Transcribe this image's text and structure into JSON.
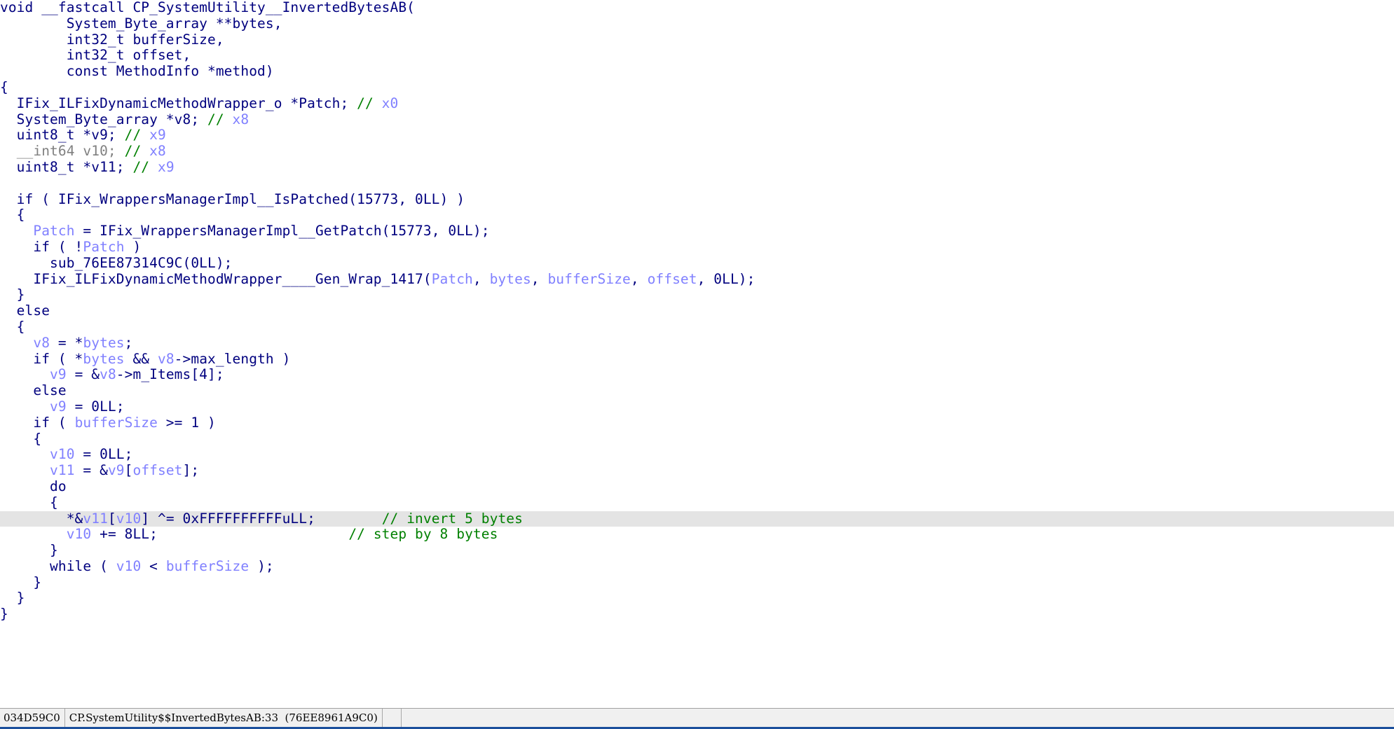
{
  "window": {
    "title": "Pseudocode-A",
    "background": "#ffffff"
  },
  "colors": {
    "default_text": "#00007f",
    "variable": "#8080ff",
    "comment": "#008000",
    "unknown_type": "#808080",
    "highlight_row": "#e4e4e4",
    "status_background": "#f0f0f0",
    "status_rule": "#1b4f9c"
  },
  "code": {
    "language": "C pseudocode",
    "highlighted_line_index": 32,
    "lines": [
      {
        "i": 0,
        "tokens": [
          {
            "c": "plain",
            "t": "void "
          },
          {
            "c": "kw",
            "t": "__fastcall"
          },
          {
            "c": "plain",
            "t": " CP_SystemUtility__InvertedBytesAB("
          }
        ]
      },
      {
        "i": 1,
        "tokens": [
          {
            "c": "plain",
            "t": "        System_Byte_array **bytes,"
          }
        ]
      },
      {
        "i": 2,
        "tokens": [
          {
            "c": "plain",
            "t": "        int32_t bufferSize,"
          }
        ]
      },
      {
        "i": 3,
        "tokens": [
          {
            "c": "plain",
            "t": "        int32_t offset,"
          }
        ]
      },
      {
        "i": 4,
        "tokens": [
          {
            "c": "plain",
            "t": "        const MethodInfo *method)"
          }
        ]
      },
      {
        "i": 5,
        "tokens": [
          {
            "c": "plain",
            "t": "{"
          }
        ]
      },
      {
        "i": 6,
        "tokens": [
          {
            "c": "plain",
            "t": "  IFix_ILFixDynamicMethodWrapper_o *Patch; "
          },
          {
            "c": "cmt",
            "t": "// "
          },
          {
            "c": "rcmt",
            "t": "x0"
          }
        ]
      },
      {
        "i": 7,
        "tokens": [
          {
            "c": "plain",
            "t": "  System_Byte_array *v8; "
          },
          {
            "c": "cmt",
            "t": "// "
          },
          {
            "c": "rcmt",
            "t": "x8"
          }
        ]
      },
      {
        "i": 8,
        "tokens": [
          {
            "c": "plain",
            "t": "  uint8_t *v9; "
          },
          {
            "c": "cmt",
            "t": "// "
          },
          {
            "c": "rcmt",
            "t": "x9"
          }
        ]
      },
      {
        "i": 9,
        "tokens": [
          {
            "c": "plain",
            "t": "  "
          },
          {
            "c": "utype",
            "t": "__int64 v10;"
          },
          {
            "c": "plain",
            "t": " "
          },
          {
            "c": "cmt",
            "t": "// "
          },
          {
            "c": "rcmt",
            "t": "x8"
          }
        ]
      },
      {
        "i": 10,
        "tokens": [
          {
            "c": "plain",
            "t": "  uint8_t *v11; "
          },
          {
            "c": "cmt",
            "t": "// "
          },
          {
            "c": "rcmt",
            "t": "x9"
          }
        ]
      },
      {
        "i": 11,
        "tokens": [
          {
            "c": "plain",
            "t": ""
          }
        ]
      },
      {
        "i": 12,
        "tokens": [
          {
            "c": "plain",
            "t": "  if ( IFix_WrappersManagerImpl__IsPatched(15773, 0LL) )"
          }
        ]
      },
      {
        "i": 13,
        "tokens": [
          {
            "c": "plain",
            "t": "  {"
          }
        ]
      },
      {
        "i": 14,
        "tokens": [
          {
            "c": "plain",
            "t": "    "
          },
          {
            "c": "var",
            "t": "Patch"
          },
          {
            "c": "plain",
            "t": " = IFix_WrappersManagerImpl__GetPatch(15773, 0LL);"
          }
        ]
      },
      {
        "i": 15,
        "tokens": [
          {
            "c": "plain",
            "t": "    if ( !"
          },
          {
            "c": "var",
            "t": "Patch"
          },
          {
            "c": "plain",
            "t": " )"
          }
        ]
      },
      {
        "i": 16,
        "tokens": [
          {
            "c": "plain",
            "t": "      sub_76EE87314C9C(0LL);"
          }
        ]
      },
      {
        "i": 17,
        "tokens": [
          {
            "c": "plain",
            "t": "    IFix_ILFixDynamicMethodWrapper____Gen_Wrap_1417("
          },
          {
            "c": "var",
            "t": "Patch"
          },
          {
            "c": "plain",
            "t": ", "
          },
          {
            "c": "var",
            "t": "bytes"
          },
          {
            "c": "plain",
            "t": ", "
          },
          {
            "c": "var",
            "t": "bufferSize"
          },
          {
            "c": "plain",
            "t": ", "
          },
          {
            "c": "var",
            "t": "offset"
          },
          {
            "c": "plain",
            "t": ", 0LL);"
          }
        ]
      },
      {
        "i": 18,
        "tokens": [
          {
            "c": "plain",
            "t": "  }"
          }
        ]
      },
      {
        "i": 19,
        "tokens": [
          {
            "c": "plain",
            "t": "  else"
          }
        ]
      },
      {
        "i": 20,
        "tokens": [
          {
            "c": "plain",
            "t": "  {"
          }
        ]
      },
      {
        "i": 21,
        "tokens": [
          {
            "c": "plain",
            "t": "    "
          },
          {
            "c": "var",
            "t": "v8"
          },
          {
            "c": "plain",
            "t": " = *"
          },
          {
            "c": "var",
            "t": "bytes"
          },
          {
            "c": "plain",
            "t": ";"
          }
        ]
      },
      {
        "i": 22,
        "tokens": [
          {
            "c": "plain",
            "t": "    if ( *"
          },
          {
            "c": "var",
            "t": "bytes"
          },
          {
            "c": "plain",
            "t": " && "
          },
          {
            "c": "var",
            "t": "v8"
          },
          {
            "c": "plain",
            "t": "->max_length )"
          }
        ]
      },
      {
        "i": 23,
        "tokens": [
          {
            "c": "plain",
            "t": "      "
          },
          {
            "c": "var",
            "t": "v9"
          },
          {
            "c": "plain",
            "t": " = &"
          },
          {
            "c": "var",
            "t": "v8"
          },
          {
            "c": "plain",
            "t": "->m_Items[4];"
          }
        ]
      },
      {
        "i": 24,
        "tokens": [
          {
            "c": "plain",
            "t": "    else"
          }
        ]
      },
      {
        "i": 25,
        "tokens": [
          {
            "c": "plain",
            "t": "      "
          },
          {
            "c": "var",
            "t": "v9"
          },
          {
            "c": "plain",
            "t": " = 0LL;"
          }
        ]
      },
      {
        "i": 26,
        "tokens": [
          {
            "c": "plain",
            "t": "    if ( "
          },
          {
            "c": "var",
            "t": "bufferSize"
          },
          {
            "c": "plain",
            "t": " >= 1 )"
          }
        ]
      },
      {
        "i": 27,
        "tokens": [
          {
            "c": "plain",
            "t": "    {"
          }
        ]
      },
      {
        "i": 28,
        "tokens": [
          {
            "c": "plain",
            "t": "      "
          },
          {
            "c": "var",
            "t": "v10"
          },
          {
            "c": "plain",
            "t": " = 0LL;"
          }
        ]
      },
      {
        "i": 29,
        "tokens": [
          {
            "c": "plain",
            "t": "      "
          },
          {
            "c": "var",
            "t": "v11"
          },
          {
            "c": "plain",
            "t": " = &"
          },
          {
            "c": "var",
            "t": "v9"
          },
          {
            "c": "plain",
            "t": "["
          },
          {
            "c": "var",
            "t": "offset"
          },
          {
            "c": "plain",
            "t": "];"
          }
        ]
      },
      {
        "i": 30,
        "tokens": [
          {
            "c": "plain",
            "t": "      do"
          }
        ]
      },
      {
        "i": 31,
        "tokens": [
          {
            "c": "plain",
            "t": "      {"
          }
        ]
      },
      {
        "i": 32,
        "tokens": [
          {
            "c": "plain",
            "t": "        *&"
          },
          {
            "c": "var",
            "t": "v11"
          },
          {
            "c": "plain",
            "t": "["
          },
          {
            "c": "var",
            "t": "v10"
          },
          {
            "c": "plain",
            "t": "] ^= 0xFFFFFFFFFFuLL;        "
          },
          {
            "c": "cmt",
            "t": "// invert 5 bytes"
          }
        ]
      },
      {
        "i": 33,
        "tokens": [
          {
            "c": "plain",
            "t": "        "
          },
          {
            "c": "var",
            "t": "v10"
          },
          {
            "c": "plain",
            "t": " += 8LL;                       "
          },
          {
            "c": "cmt",
            "t": "// step by 8 bytes"
          }
        ]
      },
      {
        "i": 34,
        "tokens": [
          {
            "c": "plain",
            "t": "      }"
          }
        ]
      },
      {
        "i": 35,
        "tokens": [
          {
            "c": "plain",
            "t": "      while ( "
          },
          {
            "c": "var",
            "t": "v10"
          },
          {
            "c": "plain",
            "t": " < "
          },
          {
            "c": "var",
            "t": "bufferSize"
          },
          {
            "c": "plain",
            "t": " );"
          }
        ]
      },
      {
        "i": 36,
        "tokens": [
          {
            "c": "plain",
            "t": "    }"
          }
        ]
      },
      {
        "i": 37,
        "tokens": [
          {
            "c": "plain",
            "t": "  }"
          }
        ]
      },
      {
        "i": 38,
        "tokens": [
          {
            "c": "plain",
            "t": "}"
          }
        ]
      }
    ]
  },
  "status_bar": {
    "address": "034D59C0",
    "location": "CP.SystemUtility$$InvertedBytesAB:33  (76EE8961A9C0)"
  }
}
